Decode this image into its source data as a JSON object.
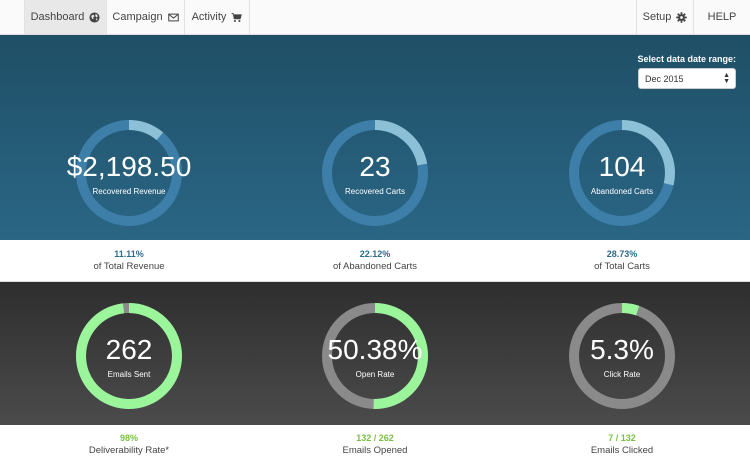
{
  "nav": {
    "left": [
      {
        "label": "Dashboard",
        "icon": "globe-icon",
        "active": true
      },
      {
        "label": "Campaign",
        "icon": "envelope-icon"
      },
      {
        "label": "Activity",
        "icon": "cart-icon"
      }
    ],
    "right": [
      {
        "label": "Setup",
        "icon": "gear-icon"
      },
      {
        "label": "HELP"
      }
    ]
  },
  "date_range": {
    "label": "Select data date range:",
    "selected": "Dec 2015"
  },
  "colors": {
    "blue_ring": "#3d7fa8",
    "blue_fill": "#8cc0d6",
    "green_ring": "#9bf59b",
    "gray_ring": "#8a8a8a",
    "blue_stat": "#2b6b8c",
    "green_stat": "#7ac142"
  },
  "recovery": [
    {
      "value": "$2,198.50",
      "label": "Recovered Revenue",
      "fraction": 0.1111,
      "stat": "11.11%",
      "stat_desc": "of Total Revenue"
    },
    {
      "value": "23",
      "label": "Recovered Carts",
      "fraction": 0.2212,
      "stat": "22.12%",
      "stat_desc": "of Abandoned Carts"
    },
    {
      "value": "104",
      "label": "Abandoned Carts",
      "fraction": 0.2873,
      "stat": "28.73%",
      "stat_desc": "of Total Carts"
    }
  ],
  "emails": [
    {
      "value": "262",
      "label": "Emails Sent",
      "fraction": 0.98,
      "stat": "98%",
      "stat_desc": "Deliverability Rate*"
    },
    {
      "value": "50.38%",
      "label": "Open Rate",
      "fraction": 0.5038,
      "stat": "132 / 262",
      "stat_desc": "Emails Opened"
    },
    {
      "value": "5.3%",
      "label": "Click Rate",
      "fraction": 0.053,
      "stat": "7 / 132",
      "stat_desc": "Emails Clicked"
    }
  ]
}
